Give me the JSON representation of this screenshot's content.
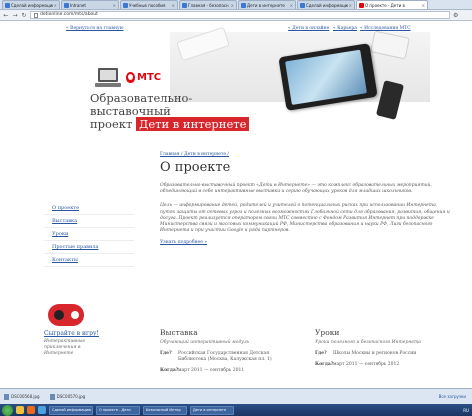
{
  "browser": {
    "tabs": [
      {
        "label": "Сделай информацию",
        "active": false,
        "fav": "blue"
      },
      {
        "label": "Intranet",
        "active": false,
        "fav": "blue"
      },
      {
        "label": "Учебные пособия",
        "active": false,
        "fav": "blue"
      },
      {
        "label": "Главная - безопасн",
        "active": false,
        "fav": "blue"
      },
      {
        "label": "Дети в интернете",
        "active": false,
        "fav": "blue"
      },
      {
        "label": "Сделай информацию",
        "active": false,
        "fav": "blue"
      },
      {
        "label": "О проекте - Дети в",
        "active": true,
        "fav": "red"
      }
    ],
    "url": "detionline.com/mts/about"
  },
  "top_links": {
    "back": "« Вернуться на главную",
    "games": "« Дети в онлайне",
    "career": "« Карьера",
    "research": "« Исследования МТС"
  },
  "hero": {
    "brand": "МТС",
    "title_line1": "Образовательно-выставочный",
    "title_line2_prefix": "проект",
    "title_line2_highlight": "Дети в интернете"
  },
  "sidebar": {
    "items": [
      {
        "label": "О проекте",
        "active": true
      },
      {
        "label": "Выставка",
        "active": false
      },
      {
        "label": "Уроки",
        "active": false
      },
      {
        "label": "Простые правила",
        "active": false
      },
      {
        "label": "Контакты",
        "active": false
      }
    ]
  },
  "game": {
    "link": "Сыграйте в игру!",
    "desc": "Интерактивные приключения в Интернете"
  },
  "main": {
    "crumb": "Главная / Дети в интернете /",
    "title": "О проекте",
    "para1": "Образовательно-выставочный проект «Дети в Интернете» — это комплекс образовательных мероприятий, объединяющий в себе интерактивные выставки и серию обучающих уроков для младших школьников.",
    "para2": "Цель — информирование детей, родителей и учителей о потенциальных рисках при использовании Интернета, путях защиты от сетевых угроз и полезных возможностях Глобальной сети для образования, развития, общения и досуга. Проект реализуется оператором связи МТС совместно с Фондом Развития Интернет при поддержке Министерства связи и массовых коммуникаций РФ, Министерства образования и науки РФ, Лиги безопасного Интернета и при участии Google и ряда партнеров.",
    "more": "Узнать подробнее »"
  },
  "columns": {
    "exhibition": {
      "title": "Выставка",
      "sub": "Обучающий интерактивный модуль",
      "where_k": "Где?",
      "where_v": "Российская Государственная Детская Библиотека (Москва, Калужская пл. 1)",
      "when_k": "Когда?",
      "when_v": "март 2011 — сентябрь 2011"
    },
    "lessons": {
      "title": "Уроки",
      "sub": "Уроки полезного и безопасного Интернета",
      "where_k": "Где?",
      "where_v": "Школы Москвы и регионов России",
      "when_k": "Когда?",
      "when_v": "март 2011 — сентябрь 2012"
    }
  },
  "shelf": {
    "items": [
      "DSC00568.jpg",
      "DSC00570.jpg"
    ],
    "right": "Все загрузки"
  },
  "taskbar": {
    "tasks": [
      "Сделай информацию",
      "О проекте - Дети",
      "Безопасный Интер",
      "Дети в интернете"
    ],
    "tray": "RU"
  }
}
